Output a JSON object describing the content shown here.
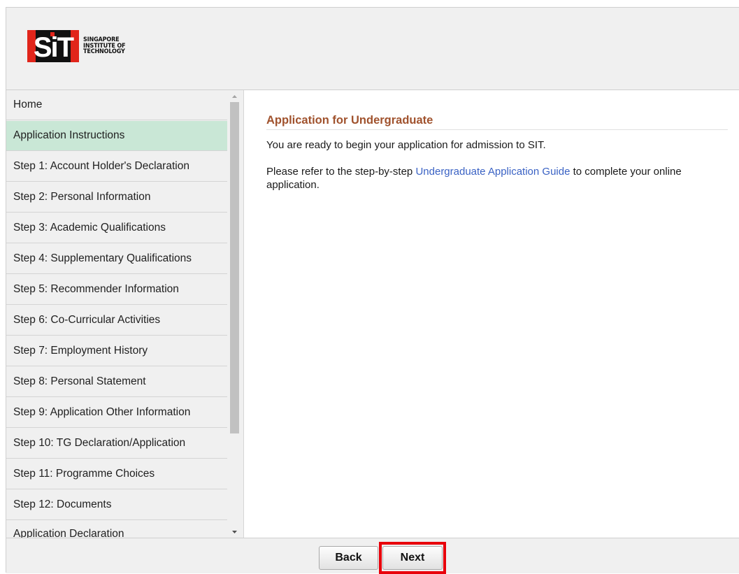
{
  "logo": {
    "mark_text": "SiT",
    "line1": "SINGAPORE",
    "line2": "INSTITUTE OF",
    "line3": "TECHNOLOGY",
    "colors": {
      "red": "#e1251b",
      "black": "#111111"
    }
  },
  "sidebar": {
    "active_color": "#c9e7d6",
    "items": [
      {
        "label": "Home",
        "active": false
      },
      {
        "label": "Application Instructions",
        "active": true
      },
      {
        "label": "Step 1: Account Holder's Declaration",
        "active": false
      },
      {
        "label": "Step 2: Personal Information",
        "active": false
      },
      {
        "label": "Step 3: Academic Qualifications",
        "active": false
      },
      {
        "label": "Step 4: Supplementary Qualifications",
        "active": false
      },
      {
        "label": "Step 5: Recommender Information",
        "active": false
      },
      {
        "label": "Step 6: Co-Curricular Activities",
        "active": false
      },
      {
        "label": "Step 7: Employment History",
        "active": false
      },
      {
        "label": "Step 8: Personal Statement",
        "active": false
      },
      {
        "label": "Step 9: Application Other Information",
        "active": false
      },
      {
        "label": "Step 10: TG Declaration/Application",
        "active": false
      },
      {
        "label": "Step 11: Programme Choices",
        "active": false
      },
      {
        "label": "Step 12: Documents",
        "active": false
      },
      {
        "label": "Application Declaration",
        "active": false
      }
    ]
  },
  "main": {
    "title": "Application for Undergraduate",
    "title_color": "#a0522d",
    "intro": "You are ready to begin your application for admission to SIT.",
    "guide_prefix": "Please refer to the step-by-step ",
    "guide_link": "Undergraduate Application Guide",
    "guide_suffix": " to complete your online application.",
    "link_color": "#3a62c4"
  },
  "footer": {
    "back_label": "Back",
    "next_label": "Next",
    "highlight_color": "#e8000b"
  }
}
